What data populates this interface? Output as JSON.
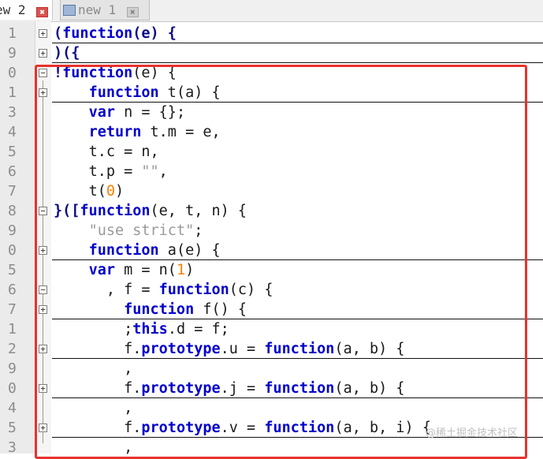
{
  "tabs": [
    {
      "label": "ew 2",
      "close": "✖"
    },
    {
      "label": "new 1",
      "close": "✖"
    }
  ],
  "line_numbers": [
    "1",
    "9",
    "0",
    "1",
    "3",
    "4",
    "5",
    "6",
    "7",
    "8",
    "9",
    "0",
    "5",
    "6",
    "7",
    "1",
    "2",
    "9",
    "0",
    "4",
    "5",
    "3"
  ],
  "colors": {
    "highlight_border": "#e8322d",
    "keyword": "#0000cc",
    "string": "#9a9a9a",
    "number": "#ff8000"
  },
  "code": {
    "l01": {
      "a": "(",
      "b": "function",
      "c": "(e) {"
    },
    "l02": {
      "a": ")({"
    },
    "l03": {
      "a": "!",
      "b": "function",
      "c": "(e) {"
    },
    "l04": {
      "indent": "    ",
      "b": "function",
      "c": " t(a) {"
    },
    "l05": {
      "indent": "    ",
      "b": "var",
      "c": " n = {};"
    },
    "l06": {
      "indent": "    ",
      "b": "return",
      "c": " t.m = e,"
    },
    "l07": {
      "indent": "    ",
      "c": "t.c = n,"
    },
    "l08": {
      "indent": "    ",
      "c": "t.p = ",
      "s": "\"\"",
      "d": ","
    },
    "l09": {
      "indent": "    ",
      "c": "t(",
      "n": "0",
      "d": ")"
    },
    "l10": {
      "a": "}([",
      "b": "function",
      "c": "(e, t, n) {"
    },
    "l11": {
      "indent": "    ",
      "s": "\"use strict\"",
      "d": ";"
    },
    "l12": {
      "indent": "    ",
      "b": "function",
      "c": " a(e) {"
    },
    "l13": {
      "indent": "    ",
      "b": "var",
      "c": " m = n(",
      "n": "1",
      "d": ")"
    },
    "l14": {
      "indent": "      ",
      "c": ", f = ",
      "b": "function",
      "d": "(c) {"
    },
    "l15": {
      "indent": "        ",
      "b": "function",
      "c": " f() {"
    },
    "l16": {
      "indent": "        ",
      "c": ";",
      "b": "this",
      "d": ".d = f;"
    },
    "l17": {
      "indent": "        ",
      "c": "f.",
      "b": "prototype",
      "d": ".u = ",
      "e": "function",
      "f": "(a, b) {"
    },
    "l18": {
      "indent": "        ",
      "c": ","
    },
    "l19": {
      "indent": "        ",
      "c": "f.",
      "b": "prototype",
      "d": ".j = ",
      "e": "function",
      "f": "(a, b) {"
    },
    "l20": {
      "indent": "        ",
      "c": ","
    },
    "l21": {
      "indent": "        ",
      "c": "f.",
      "b": "prototype",
      "d": ".v = ",
      "e": "function",
      "f": "(a, b, i) {"
    },
    "l22": {
      "indent": "        ",
      "c": ","
    }
  },
  "watermark": "@稀土掘金技术社区"
}
